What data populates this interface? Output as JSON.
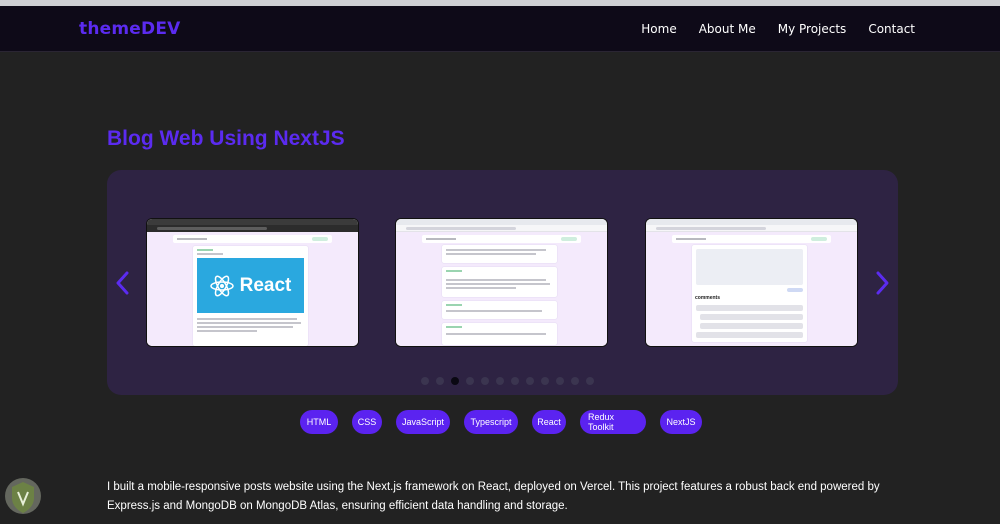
{
  "navbar": {
    "brand": "themeDEV",
    "links": [
      "Home",
      "About Me",
      "My Projects",
      "Contact"
    ]
  },
  "project": {
    "title": "Blog Web Using NextJS",
    "slides": [
      {
        "name": "slide-react-post",
        "banner_text": "React"
      },
      {
        "name": "slide-posts-list"
      },
      {
        "name": "slide-comments",
        "section_label": "comments"
      }
    ],
    "dot_count": 12,
    "active_dot": 2,
    "tags": [
      "HTML",
      "CSS",
      "JavaScript",
      "Typescript",
      "React",
      "Redux Toolkit",
      "NextJS"
    ],
    "description": "I built a mobile-responsive posts website using the Next.js framework on React, deployed on Vercel. This project features a robust back end powered by Express.js and MongoDB on MongoDB Atlas, ensuring efficient data handling and storage."
  },
  "colors": {
    "accent": "#5b2bf0",
    "background": "#222222",
    "carousel_bg": "#2e2343",
    "tag_bg": "#5b23f0"
  },
  "icons": {
    "prev": "chevron-left-icon",
    "next": "chevron-right-icon",
    "watermark": "shield-logo-icon"
  }
}
